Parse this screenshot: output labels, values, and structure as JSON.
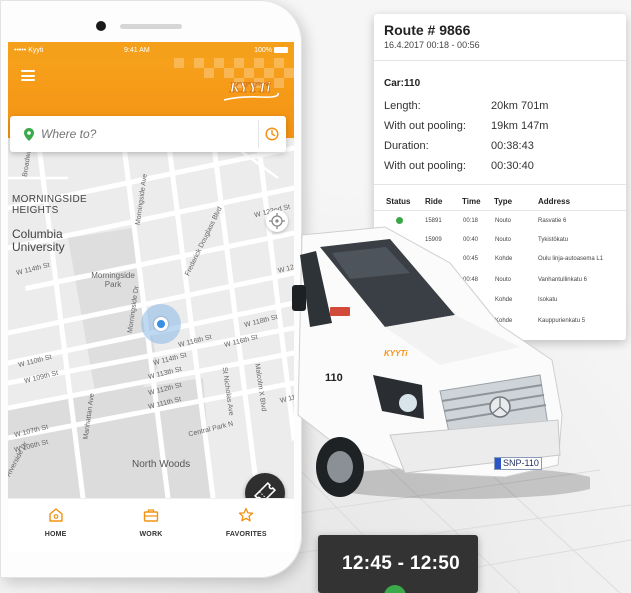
{
  "status_bar": {
    "carrier": "••••• Kyyti",
    "time": "9:41 AM",
    "battery": "100%"
  },
  "app": {
    "brand": "KYYTi",
    "accent_color": "#f39214"
  },
  "search": {
    "placeholder": "Where to?",
    "pin_icon": "location-pin-icon",
    "time_icon": "clock-icon"
  },
  "map": {
    "area_label": "MORNINGSIDE HEIGHTS",
    "campus_label": "Columbia University",
    "park_label": "Morningside Park",
    "woods_label": "North Woods",
    "streets": [
      "W 114th St",
      "W 116th St",
      "W 114th St",
      "W 113th St",
      "W 112th St",
      "W 111th St",
      "W 110th St",
      "W 109th St",
      "W 118th St",
      "W 116th St",
      "W 122nd St",
      "W 12",
      "W 11",
      "Morningside Dr",
      "Manhattan Ave",
      "Frederick Douglass Blvd",
      "St Nicholas Ave",
      "Malcolm X Blvd",
      "Central Park N",
      "Morningside Ave",
      "Broadway",
      "W 107th St",
      "W 106th St",
      "Riverside Dr"
    ]
  },
  "bottom_nav": [
    {
      "label": "HOME",
      "icon": "home-icon"
    },
    {
      "label": "WORK",
      "icon": "briefcase-icon"
    },
    {
      "label": "FAVORITES",
      "icon": "star-icon"
    }
  ],
  "route": {
    "title": "Route # 9866",
    "daterange": "16.4.2017 00:18 - 00:56",
    "car": "Car:110",
    "stats": [
      {
        "key": "Length:",
        "value": "20km 701m"
      },
      {
        "key": "With out pooling:",
        "value": "19km 147m"
      },
      {
        "key": "Duration:",
        "value": "00:38:43"
      },
      {
        "key": "With out pooling:",
        "value": "00:30:40"
      }
    ],
    "table": {
      "headers": [
        "Status",
        "Ride",
        "Time",
        "Type",
        "Address"
      ],
      "rows": [
        {
          "status": "done",
          "ride": "15891",
          "time": "00:18",
          "type": "Nouto",
          "address": "Rasvatie 6"
        },
        {
          "status": "done",
          "ride": "15909",
          "time": "00:40",
          "type": "Nouto",
          "address": "Tykistökatu"
        },
        {
          "status": "",
          "ride": "",
          "time": "00:45",
          "type": "Kohde",
          "address": "Oulu linja-autoasema L1"
        },
        {
          "status": "",
          "ride": "",
          "time": "00:48",
          "type": "Nouto",
          "address": "Vanhantullinkatu 6"
        },
        {
          "status": "",
          "ride": "",
          "time": "",
          "type": "Kohde",
          "address": "Isokatu"
        },
        {
          "status": "",
          "ride": "",
          "time": "",
          "type": "Kohde",
          "address": "Kauppurienkatu 5"
        }
      ]
    }
  },
  "van": {
    "number": "110",
    "plate": "SNP-110",
    "logo": "KYYTi"
  },
  "eta": {
    "time_range": "12:45 - 12:50"
  }
}
